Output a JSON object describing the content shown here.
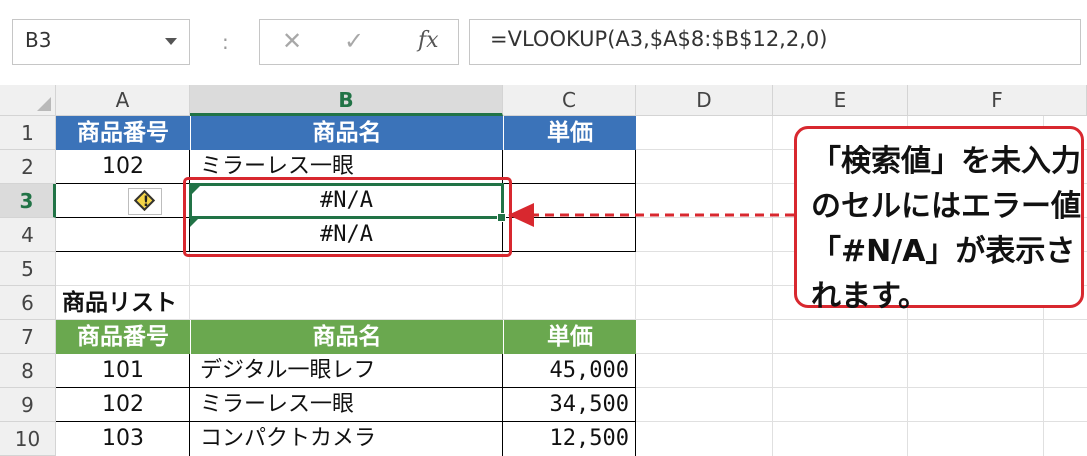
{
  "formula_bar": {
    "name_box": "B3",
    "separator": ":",
    "cancel_symbol": "✕",
    "enter_symbol": "✓",
    "fx_symbol": "fx",
    "formula": "=VLOOKUP(A3,$A$8:$B$12,2,0)"
  },
  "columns": [
    "A",
    "B",
    "C",
    "D",
    "E",
    "F"
  ],
  "rows": [
    "1",
    "2",
    "3",
    "4",
    "5",
    "6",
    "7",
    "8",
    "9",
    "10"
  ],
  "table1": {
    "headers": [
      "商品番号",
      "商品名",
      "単価"
    ],
    "rows": [
      {
        "code": "102",
        "name": "ミラーレス一眼",
        "price": ""
      },
      {
        "code": "",
        "name": "#N/A",
        "price": ""
      },
      {
        "code": "",
        "name": "#N/A",
        "price": ""
      }
    ]
  },
  "table2": {
    "title": "商品リスト",
    "headers": [
      "商品番号",
      "商品名",
      "単価"
    ],
    "rows": [
      {
        "code": "101",
        "name": "デジタル一眼レフ",
        "price": "45,000"
      },
      {
        "code": "102",
        "name": "ミラーレス一眼",
        "price": "34,500"
      },
      {
        "code": "103",
        "name": "コンパクトカメラ",
        "price": "12,500"
      }
    ]
  },
  "error_icon": "warning-diamond-icon",
  "callout": {
    "text": "「検索値」を未入力のセルにはエラー値「#N/A」が表示されます。"
  },
  "colors": {
    "header_blue": "#3b73b9",
    "header_green": "#6aa84f",
    "selection_green": "#217346",
    "highlight_red": "#d8282f"
  }
}
